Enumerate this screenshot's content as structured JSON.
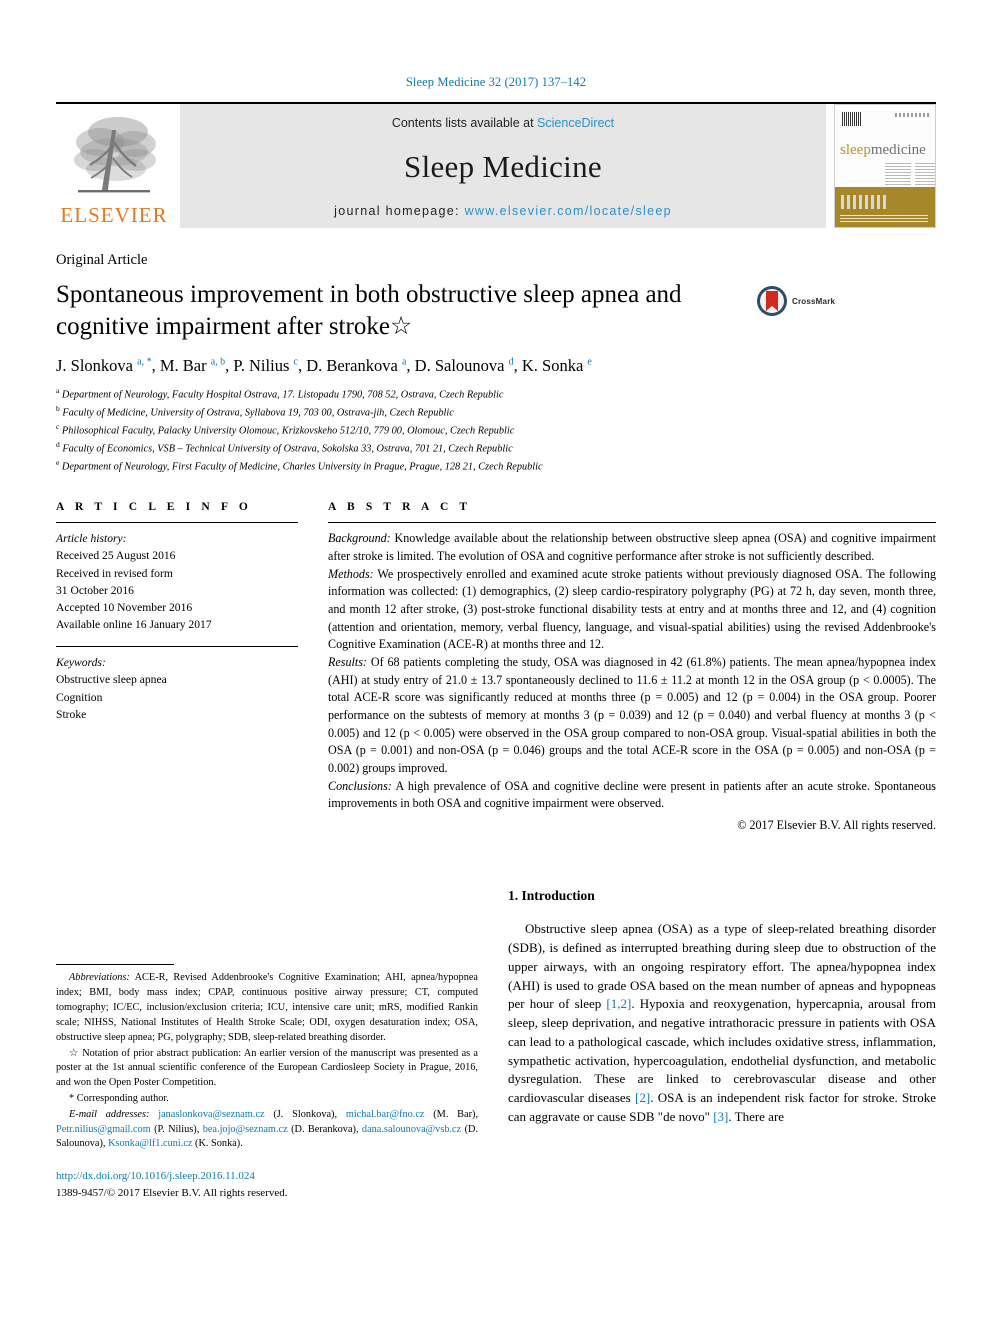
{
  "running_head": "Sleep Medicine 32 (2017) 137–142",
  "masthead": {
    "contents_prefix": "Contents lists available at",
    "sciencedirect": "ScienceDirect",
    "journal_name": "Sleep Medicine",
    "homepage_prefix": "journal homepage:",
    "homepage_url": "www.elsevier.com/locate/sleep",
    "publisher": "ELSEVIER",
    "cover_title_part1": "sleep",
    "cover_title_part2": "medicine",
    "accent_link_color": "#2a8fcf",
    "elsevier_orange": "#E87722"
  },
  "article": {
    "type": "Original Article",
    "title": "Spontaneous improvement in both obstructive sleep apnea and cognitive impairment after stroke☆",
    "crossmark_label": "CrossMark",
    "authors_html": "J. Slonkova <sup>a, *</sup>, M. Bar <sup>a, b</sup>, P. Nilius <sup>c</sup>, D. Berankova <sup>a</sup>, D. Salounova <sup>d</sup>, K. Sonka <sup>e</sup>",
    "affiliations": [
      {
        "mark": "a",
        "text": "Department of Neurology, Faculty Hospital Ostrava, 17. Listopadu 1790, 708 52, Ostrava, Czech Republic"
      },
      {
        "mark": "b",
        "text": "Faculty of Medicine, University of Ostrava, Syllabova 19, 703 00, Ostrava-jih, Czech Republic"
      },
      {
        "mark": "c",
        "text": "Philosophical Faculty, Palacky University Olomouc, Krizkovskeho 512/10, 779 00, Olomouc, Czech Republic"
      },
      {
        "mark": "d",
        "text": "Faculty of Economics, VSB – Technical University of Ostrava, Sokolska 33, Ostrava, 701 21, Czech Republic"
      },
      {
        "mark": "e",
        "text": "Department of Neurology, First Faculty of Medicine, Charles University in Prague, Prague, 128 21, Czech Republic"
      }
    ]
  },
  "article_info": {
    "heading": "A R T I C L E  I N F O",
    "history_label": "Article history:",
    "history": [
      "Received 25 August 2016",
      "Received in revised form",
      "31 October 2016",
      "Accepted 10 November 2016",
      "Available online 16 January 2017"
    ],
    "keywords_label": "Keywords:",
    "keywords": [
      "Obstructive sleep apnea",
      "Cognition",
      "Stroke"
    ]
  },
  "abstract": {
    "heading": "A B S T R A C T",
    "background_label": "Background:",
    "background_text": " Knowledge available about the relationship between obstructive sleep apnea (OSA) and cognitive impairment after stroke is limited. The evolution of OSA and cognitive performance after stroke is not sufficiently described.",
    "methods_label": "Methods:",
    "methods_text": " We prospectively enrolled and examined acute stroke patients without previously diagnosed OSA. The following information was collected: (1) demographics, (2) sleep cardio-respiratory polygraphy (PG) at 72 h, day seven, month three, and month 12 after stroke, (3) post-stroke functional disability tests at entry and at months three and 12, and (4) cognition (attention and orientation, memory, verbal fluency, language, and visual-spatial abilities) using the revised Addenbrooke's Cognitive Examination (ACE-R) at months three and 12.",
    "results_label": "Results:",
    "results_text": " Of 68 patients completing the study, OSA was diagnosed in 42 (61.8%) patients. The mean apnea/hypopnea index (AHI) at study entry of 21.0 ± 13.7 spontaneously declined to 11.6 ± 11.2 at month 12 in the OSA group (p < 0.0005). The total ACE-R score was significantly reduced at months three (p = 0.005) and 12 (p = 0.004) in the OSA group. Poorer performance on the subtests of memory at months 3 (p = 0.039) and 12 (p = 0.040) and verbal fluency at months 3 (p < 0.005) and 12 (p < 0.005) were observed in the OSA group compared to non-OSA group. Visual-spatial abilities in both the OSA (p = 0.001) and non-OSA (p = 0.046) groups and the total ACE-R score in the OSA (p = 0.005) and non-OSA (p = 0.002) groups improved.",
    "conclusions_label": "Conclusions:",
    "conclusions_text": " A high prevalence of OSA and cognitive decline were present in patients after an acute stroke. Spontaneous improvements in both OSA and cognitive impairment were observed.",
    "copyright": "© 2017 Elsevier B.V. All rights reserved."
  },
  "footnotes": {
    "abbreviations_label": "Abbreviations:",
    "abbreviations_text": " ACE-R, Revised Addenbrooke's Cognitive Examination; AHI, apnea/hypopnea index; BMI, body mass index; CPAP, continuous positive airway pressure; CT, computed tomography; IC/EC, inclusion/exclusion criteria; ICU, intensive care unit; mRS, modified Rankin scale; NIHSS, National Institutes of Health Stroke Scale; ODI, oxygen desaturation index; OSA, obstructive sleep apnea; PG, polygraphy; SDB, sleep-related breathing disorder.",
    "star_note": "☆ Notation of prior abstract publication: An earlier version of the manuscript was presented as a poster at the 1st annual scientific conference of the European Cardiosleep Society in Prague, 2016, and won the Open Poster Competition.",
    "corresponding": "* Corresponding author.",
    "email_label": "E-mail addresses:",
    "emails": [
      {
        "address": "janaslonkova@seznam.cz",
        "name": "(J. Slonkova),"
      },
      {
        "address": "michal.bar@fno.cz",
        "name": "(M. Bar),"
      },
      {
        "address": "Petr.nilius@gmail.com",
        "name": "(P. Nilius),"
      },
      {
        "address": "bea.jojo@seznam.cz",
        "name": "(D. Berankova),"
      },
      {
        "address": "dana.salounova@vsb.cz",
        "name": "(D. Salounova),"
      },
      {
        "address": "Ksonka@lf1.cuni.cz",
        "name": "(K. Sonka)."
      }
    ],
    "doi": "http://dx.doi.org/10.1016/j.sleep.2016.11.024",
    "issn_line": "1389-9457/© 2017 Elsevier B.V. All rights reserved."
  },
  "introduction": {
    "number_title": "1. Introduction",
    "paragraph_part1": "Obstructive sleep apnea (OSA) as a type of sleep-related breathing disorder (SDB), is defined as interrupted breathing during sleep due to obstruction of the upper airways, with an ongoing respiratory effort. The apnea/hypopnea index (AHI) is used to grade OSA based on the mean number of apneas and hypopneas per hour of sleep ",
    "cite1": "[1,2]",
    "paragraph_part2": ". Hypoxia and reoxygenation, hypercapnia, arousal from sleep, sleep deprivation, and negative intrathoracic pressure in patients with OSA can lead to a pathological cascade, which includes oxidative stress, inflammation, sympathetic activation, hypercoagulation, endothelial dysfunction, and metabolic dysregulation. These are linked to cerebrovascular disease and other cardiovascular diseases ",
    "cite2": "[2]",
    "paragraph_part3": ". OSA is an independent risk factor for stroke. Stroke can aggravate or cause SDB \"de novo\" ",
    "cite3": "[3]",
    "paragraph_part4": ". There are"
  }
}
